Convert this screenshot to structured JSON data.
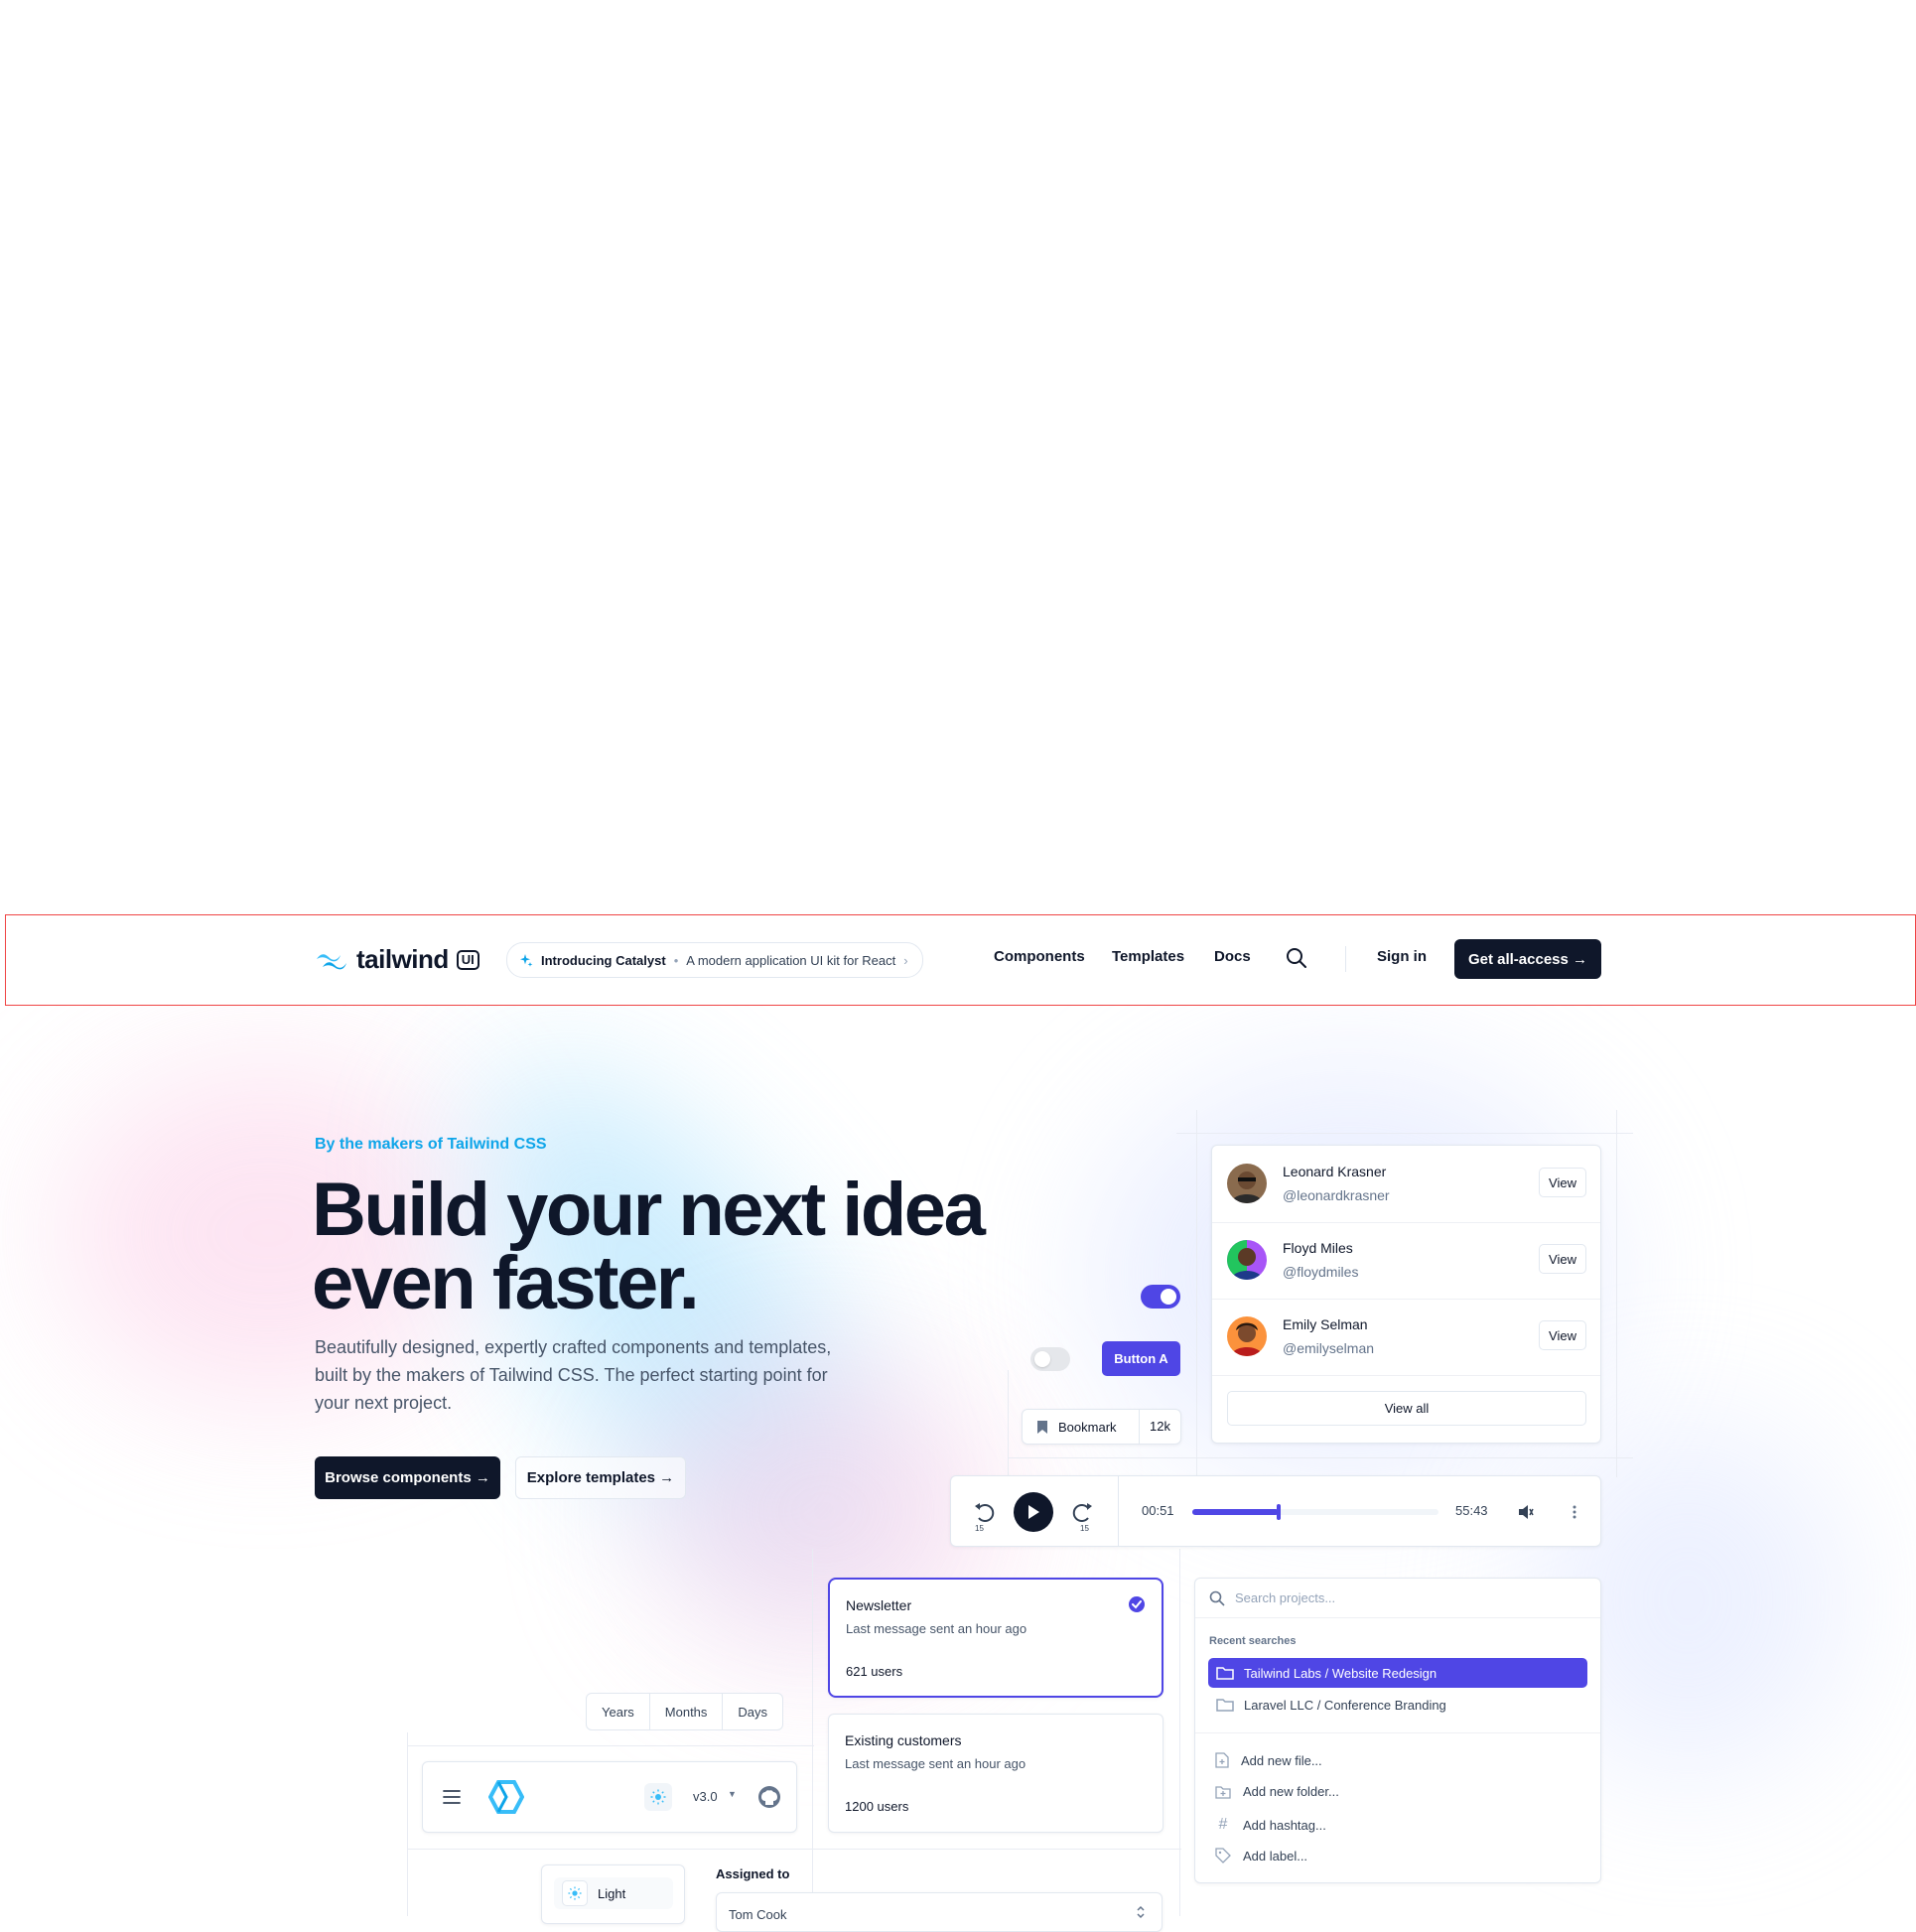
{
  "header": {
    "logo_word": "tailwind",
    "logo_badge": "UI",
    "announcement_title": "Introducing Catalyst",
    "announcement_text": "A modern application UI kit for React",
    "nav": [
      "Components",
      "Templates",
      "Docs"
    ],
    "sign_in": "Sign in",
    "cta": "Get all-access →"
  },
  "hero": {
    "eyebrow": "By the makers of Tailwind CSS",
    "title_line1": "Build your next idea",
    "title_line2": "even faster.",
    "lead": "Beautifully designed, expertly crafted components and templates, built by the makers of Tailwind CSS. The perfect starting point for your next project.",
    "primary_button": "Browse components →",
    "secondary_button": "Explore templates →"
  },
  "people": {
    "users": [
      {
        "name": "Leonard Krasner",
        "handle": "@leonardkrasner",
        "action": "View"
      },
      {
        "name": "Floyd Miles",
        "handle": "@floydmiles",
        "action": "View"
      },
      {
        "name": "Emily Selman",
        "handle": "@emilyselman",
        "action": "View"
      }
    ],
    "view_all": "View all"
  },
  "widgets": {
    "button_a": "Button A",
    "bookmark_label": "Bookmark",
    "bookmark_count": "12k",
    "toggle_on": true,
    "toggle_off": false
  },
  "player": {
    "skip_back": "15",
    "skip_forward": "15",
    "current_time": "00:51",
    "duration": "55:43",
    "progress": 0.35
  },
  "mailing_lists": [
    {
      "title": "Newsletter",
      "subtitle": "Last message sent an hour ago",
      "count": "621 users",
      "selected": true
    },
    {
      "title": "Existing customers",
      "subtitle": "Last message sent an hour ago",
      "count": "1200 users",
      "selected": false
    }
  ],
  "search": {
    "placeholder": "Search projects...",
    "recent_label": "Recent searches",
    "recent": [
      "Tailwind Labs / Website Redesign",
      "Laravel LLC / Conference Branding"
    ],
    "actions": [
      "Add new file...",
      "Add new folder...",
      "Add hashtag...",
      "Add label..."
    ]
  },
  "segmented": [
    "Years",
    "Months",
    "Days"
  ],
  "docs_bar": {
    "version": "v3.0"
  },
  "theme": {
    "label": "Light"
  },
  "assigned": {
    "label": "Assigned to",
    "value": "Tom Cook"
  },
  "colors": {
    "accent": "#4f46e5",
    "sky": "#0ea5e9",
    "dark": "#0f172a"
  }
}
